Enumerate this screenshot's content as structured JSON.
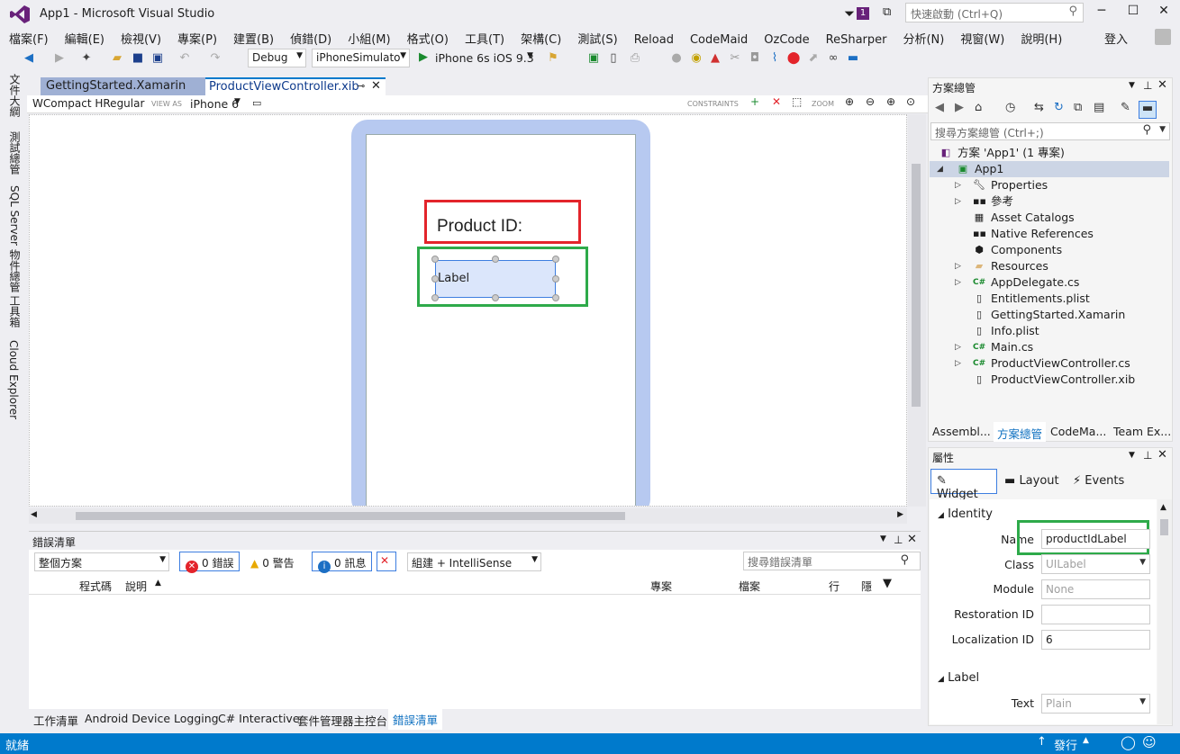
{
  "window": {
    "title": "App1 - Microsoft Visual Studio",
    "quick_launch_placeholder": "快速啟動 (Ctrl+Q)",
    "notification_count": "1"
  },
  "menu": [
    "檔案(F)",
    "編輯(E)",
    "檢視(V)",
    "專案(P)",
    "建置(B)",
    "偵錯(D)",
    "小組(M)",
    "格式(O)",
    "工具(T)",
    "架構(C)",
    "測試(S)",
    "Reload",
    "CodeMaid",
    "OzCode",
    "ReSharper",
    "分析(N)",
    "視窗(W)",
    "說明(H)"
  ],
  "login": "登入",
  "toolbar": {
    "config": "Debug",
    "platform": "iPhoneSimulato",
    "run_target": "iPhone 6s iOS 9.3"
  },
  "left_tabs": [
    "文件大綱",
    "測試總管",
    "SQL Server 物件總管",
    "工具箱",
    "Cloud Explorer"
  ],
  "doc_tabs": [
    {
      "label": "GettingStarted.Xamarin",
      "active": false
    },
    {
      "label": "ProductViewController.xib",
      "active": true
    }
  ],
  "designer": {
    "size_class": "WCompact HRegular",
    "view_as_label": "VIEW AS",
    "device": "iPhone 6",
    "constraints_label": "CONSTRAINTS",
    "zoom_label": "ZOOM"
  },
  "canvas": {
    "title_label": "Product ID:",
    "label_widget": "Label"
  },
  "error_list": {
    "title": "錯誤清單",
    "scope": "整個方案",
    "errors": "0 錯誤",
    "warnings": "0 警告",
    "messages": "0 訊息",
    "source": "組建 + IntelliSense",
    "search_placeholder": "搜尋錯誤清單",
    "columns": [
      "程式碼",
      "說明",
      "專案",
      "檔案",
      "行",
      "隱"
    ]
  },
  "bottom_tabs": [
    {
      "label": "工作清單",
      "active": false
    },
    {
      "label": "Android Device Logging",
      "active": false
    },
    {
      "label": "C# Interactive",
      "active": false
    },
    {
      "label": "套件管理器主控台",
      "active": false
    },
    {
      "label": "錯誤清單",
      "active": true
    }
  ],
  "status": {
    "left": "就緒",
    "publish": "發行"
  },
  "solution_explorer": {
    "title": "方案總管",
    "search_placeholder": "搜尋方案總管 (Ctrl+;)",
    "solution": "方案 'App1' (1 專案)",
    "project": "App1",
    "items": [
      {
        "label": "Properties",
        "icon": "wrench-icon",
        "expandable": true
      },
      {
        "label": "參考",
        "icon": "references-icon",
        "expandable": true
      },
      {
        "label": "Asset Catalogs",
        "icon": "catalog-icon",
        "expandable": false
      },
      {
        "label": "Native References",
        "icon": "references-icon",
        "expandable": false
      },
      {
        "label": "Components",
        "icon": "component-icon",
        "expandable": false
      },
      {
        "label": "Resources",
        "icon": "folder-icon",
        "expandable": true
      },
      {
        "label": "AppDelegate.cs",
        "icon": "csharp-icon",
        "expandable": true
      },
      {
        "label": "Entitlements.plist",
        "icon": "file-icon",
        "expandable": false
      },
      {
        "label": "GettingStarted.Xamarin",
        "icon": "file-icon",
        "expandable": false
      },
      {
        "label": "Info.plist",
        "icon": "file-icon",
        "expandable": false
      },
      {
        "label": "Main.cs",
        "icon": "csharp-icon",
        "expandable": true
      },
      {
        "label": "ProductViewController.cs",
        "icon": "csharp-icon",
        "expandable": true
      },
      {
        "label": "ProductViewController.xib",
        "icon": "file-icon",
        "expandable": false
      }
    ],
    "tabs": [
      "Assembl...",
      "方案總管",
      "CodeMa...",
      "Team Ex..."
    ]
  },
  "properties": {
    "title": "屬性",
    "tabs": [
      "Widget",
      "Layout",
      "Events"
    ],
    "identity_section": "Identity",
    "name_label": "Name",
    "name_value": "productIdLabel",
    "class_label": "Class",
    "class_value": "UILabel",
    "module_label": "Module",
    "module_value": "None",
    "restoration_label": "Restoration ID",
    "restoration_value": "",
    "localization_label": "Localization ID",
    "localization_value": "6",
    "label_section": "Label",
    "text_label": "Text",
    "text_value": "Plain"
  },
  "colors": {
    "accent": "#007acc",
    "vs_purple": "#68217a",
    "highlight_red": "#e3242b",
    "highlight_green": "#2eaa4a"
  }
}
